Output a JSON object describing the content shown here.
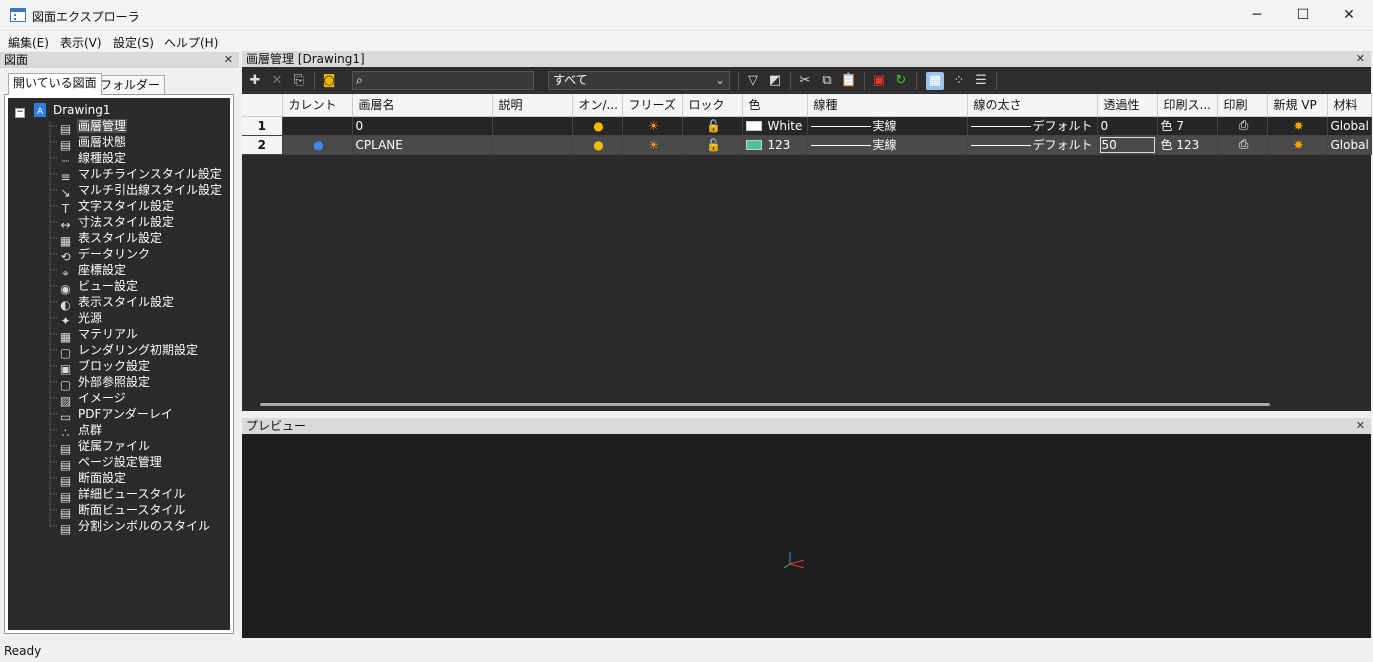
{
  "window": {
    "title": "図面エクスプローラ"
  },
  "menu": [
    "編集(E)",
    "表示(V)",
    "設定(S)",
    "ヘルプ(H)"
  ],
  "left_panel": {
    "title": "図面",
    "tabs": [
      "開いている図面",
      "フォルダー"
    ],
    "root": "Drawing1",
    "items": [
      "画層管理",
      "画層状態",
      "線種設定",
      "マルチラインスタイル設定",
      "マルチ引出線スタイル設定",
      "文字スタイル設定",
      "寸法スタイル設定",
      "表スタイル設定",
      "データリンク",
      "座標設定",
      "ビュー設定",
      "表示スタイル設定",
      "光源",
      "マテリアル",
      "レンダリング初期設定",
      "ブロック設定",
      "外部参照設定",
      "イメージ",
      "PDFアンダーレイ",
      "点群",
      "従属ファイル",
      "ページ設定管理",
      "断面設定",
      "詳細ビュースタイル",
      "断面ビュースタイル",
      "分割シンボルのスタイル"
    ]
  },
  "layer_panel": {
    "title": "画層管理 [Drawing1]",
    "search_placeholder": "",
    "filter": "すべて",
    "columns": [
      "カレント",
      "画層名",
      "説明",
      "オン/...",
      "フリーズ",
      "ロック",
      "色",
      "線種",
      "線の太さ",
      "透過性",
      "印刷ス...",
      "印刷",
      "新規 VP",
      "材料"
    ],
    "rows": [
      {
        "num": "1",
        "current": "",
        "name": "0",
        "desc": "",
        "color_hex": "#ffffff",
        "color_name": "White",
        "linetype": "実線",
        "lineweight": "デフォルト",
        "transparency": "0",
        "plot_style": "色 7",
        "material": "Global"
      },
      {
        "num": "2",
        "current": "●",
        "name": "CPLANE",
        "desc": "",
        "color_hex": "#4fc0a0",
        "color_name": "123",
        "linetype": "実線",
        "lineweight": "デフォルト",
        "transparency": "50",
        "plot_style": "色 123",
        "material": "Global"
      }
    ]
  },
  "preview_panel": {
    "title": "プレビュー"
  },
  "status": "Ready"
}
